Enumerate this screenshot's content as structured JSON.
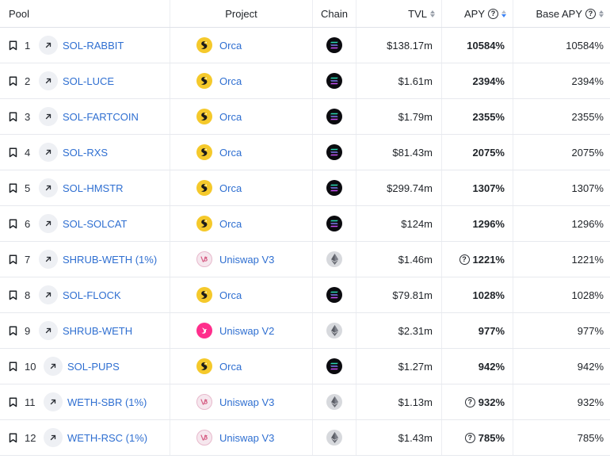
{
  "header": {
    "pool": "Pool",
    "project": "Project",
    "chain": "Chain",
    "tvl": "TVL",
    "apy": "APY",
    "base_apy": "Base APY"
  },
  "rows": [
    {
      "rank": "1",
      "pool": "SOL-RABBIT",
      "project": "Orca",
      "project_logo": "orca",
      "chain": "solana",
      "tvl": "$138.17m",
      "apy": "10584%",
      "apy_help": false,
      "base_apy": "10584%"
    },
    {
      "rank": "2",
      "pool": "SOL-LUCE",
      "project": "Orca",
      "project_logo": "orca",
      "chain": "solana",
      "tvl": "$1.61m",
      "apy": "2394%",
      "apy_help": false,
      "base_apy": "2394%"
    },
    {
      "rank": "3",
      "pool": "SOL-FARTCOIN",
      "project": "Orca",
      "project_logo": "orca",
      "chain": "solana",
      "tvl": "$1.79m",
      "apy": "2355%",
      "apy_help": false,
      "base_apy": "2355%"
    },
    {
      "rank": "4",
      "pool": "SOL-RXS",
      "project": "Orca",
      "project_logo": "orca",
      "chain": "solana",
      "tvl": "$81.43m",
      "apy": "2075%",
      "apy_help": false,
      "base_apy": "2075%"
    },
    {
      "rank": "5",
      "pool": "SOL-HMSTR",
      "project": "Orca",
      "project_logo": "orca",
      "chain": "solana",
      "tvl": "$299.74m",
      "apy": "1307%",
      "apy_help": false,
      "base_apy": "1307%"
    },
    {
      "rank": "6",
      "pool": "SOL-SOLCAT",
      "project": "Orca",
      "project_logo": "orca",
      "chain": "solana",
      "tvl": "$124m",
      "apy": "1296%",
      "apy_help": false,
      "base_apy": "1296%"
    },
    {
      "rank": "7",
      "pool": "SHRUB-WETH (1%)",
      "project": "Uniswap V3",
      "project_logo": "uniswap-v3",
      "chain": "ethereum",
      "tvl": "$1.46m",
      "apy": "1221%",
      "apy_help": true,
      "base_apy": "1221%"
    },
    {
      "rank": "8",
      "pool": "SOL-FLOCK",
      "project": "Orca",
      "project_logo": "orca",
      "chain": "solana",
      "tvl": "$79.81m",
      "apy": "1028%",
      "apy_help": false,
      "base_apy": "1028%"
    },
    {
      "rank": "9",
      "pool": "SHRUB-WETH",
      "project": "Uniswap V2",
      "project_logo": "uniswap-v2",
      "chain": "ethereum",
      "tvl": "$2.31m",
      "apy": "977%",
      "apy_help": false,
      "base_apy": "977%"
    },
    {
      "rank": "10",
      "pool": "SOL-PUPS",
      "project": "Orca",
      "project_logo": "orca",
      "chain": "solana",
      "tvl": "$1.27m",
      "apy": "942%",
      "apy_help": false,
      "base_apy": "942%"
    },
    {
      "rank": "11",
      "pool": "WETH-SBR (1%)",
      "project": "Uniswap V3",
      "project_logo": "uniswap-v3",
      "chain": "ethereum",
      "tvl": "$1.13m",
      "apy": "932%",
      "apy_help": true,
      "base_apy": "932%"
    },
    {
      "rank": "12",
      "pool": "WETH-RSC (1%)",
      "project": "Uniswap V3",
      "project_logo": "uniswap-v3",
      "chain": "ethereum",
      "tvl": "$1.43m",
      "apy": "785%",
      "apy_help": true,
      "base_apy": "785%"
    }
  ],
  "colors": {
    "link": "#2f6fd1",
    "sort_active": "#3b82f6",
    "orca": "#f5c92b",
    "uniswap_v2": "#ff2e8c",
    "solana_bg": "#0b0b0f",
    "ethereum_bg": "#d7d9dd"
  },
  "sort": {
    "column": "apy",
    "direction": "desc"
  }
}
